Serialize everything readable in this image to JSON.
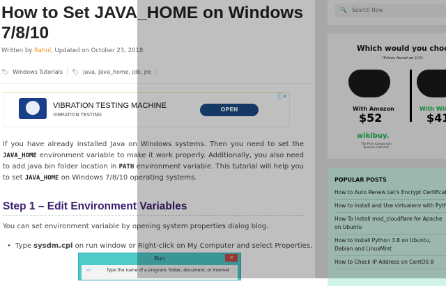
{
  "article": {
    "title": "How to Set JAVA_HOME on Windows 7/8/10",
    "meta_prefix": "Written by ",
    "author": "Rahul",
    "meta_suffix": ", Updated on October 23, 2018",
    "category": "Windows Tutorials",
    "tags": "java, Java_home, jdk, jre",
    "intro": [
      "If you have already installed Java on Windows systems. Then you need to set the ",
      "JAVA_HOME",
      " environment variable to make it work properly. Additionally, you also need to add java bin folder location in ",
      "PATH",
      " environment variable. This tutorial will help you to set ",
      "JAVA_HOME",
      " on Windows 7/8/10 operating systems."
    ],
    "step_heading": "Step 1 – Edit Environment Variables",
    "para": "You can set environment variable by opening system properties dialog blog.",
    "bullet": [
      "Type ",
      "sysdm.cpl",
      " on run window or Right-click on My Computer and select Properties."
    ],
    "run_dialog": {
      "title": "Run",
      "close": "×",
      "text": "Type the name of a program, folder, document, or Internet"
    }
  },
  "ad": {
    "title": "VIBRATION TESTING MACHINE",
    "subtitle": "VIBRATION TESTING",
    "button": "OPEN",
    "info": "ⓘ✕"
  },
  "sidebar": {
    "search_placeholder": "Search Now",
    "search_icon": "search-icon",
    "ad": {
      "heading": "Which would you choose",
      "sub": "*Prices found on 1/31",
      "left_label": "With Amazon",
      "left_price": "$52",
      "right_label": "With Wiki",
      "right_price": "$41",
      "brand": "wikibuy.",
      "brand_sub": "The Price Comparison Browser Extension"
    },
    "popular": {
      "heading": "POPULAR POSTS",
      "items": [
        "How to Auto Renew Let's Encrypt Certificate",
        "How to Install and Use virtualenv with Python",
        "How To Install mod_cloudflare for Apache on Ubuntu",
        "How to Install Python 3.8 on Ubuntu, Debian and LinuxMint",
        "How to Check IP Address on CentOS 8"
      ]
    }
  },
  "colors": {
    "author": "#f7941d",
    "heading": "#3b1d6e",
    "ad_button": "#1a4c86",
    "wikibuy": "#1ab34c"
  }
}
